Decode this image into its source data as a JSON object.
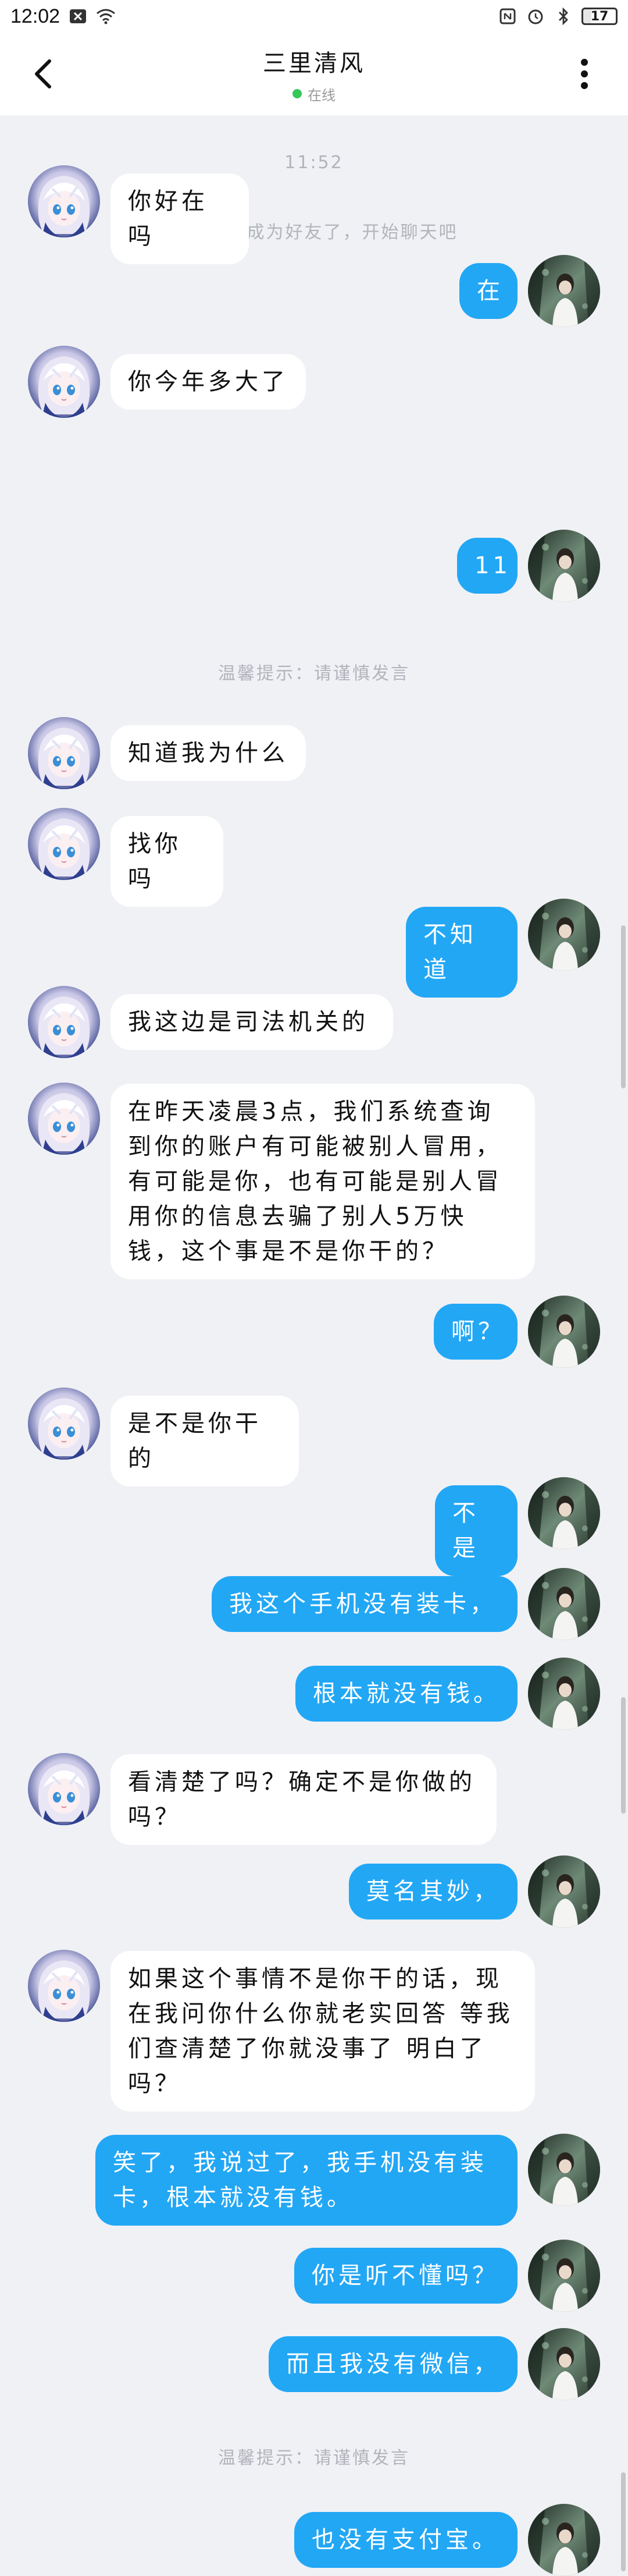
{
  "status_bar": {
    "time": "12:02",
    "battery": "17",
    "icons": [
      "notification-x-icon",
      "wifi-icon",
      "nfc-icon",
      "alarm-icon",
      "bluetooth-icon",
      "battery-icon"
    ]
  },
  "header": {
    "contact_name": "三里清风",
    "presence": "在线",
    "presence_color": "#34c759",
    "back_icon": "chevron-left-icon",
    "more_icon": "more-vertical-icon"
  },
  "chat": {
    "timestamp": "11:52",
    "friend_notice": "你们已经成为好友了，开始聊天吧",
    "tip_1": "温馨提示：请谨慎发言",
    "tip_2": "温馨提示：请谨慎发言",
    "incoming_color": "#ffffff",
    "outgoing_color": "#22a7f5",
    "messages": [
      {
        "side": "in",
        "text": "你好在吗"
      },
      {
        "side": "out",
        "text": "在"
      },
      {
        "side": "in",
        "text": "你今年多大了"
      },
      {
        "side": "out",
        "text": "11"
      },
      {
        "side": "in",
        "text": "知道我为什么"
      },
      {
        "side": "in",
        "text": "找你吗"
      },
      {
        "side": "out",
        "text": "不知道"
      },
      {
        "side": "in",
        "text": "我这边是司法机关的"
      },
      {
        "side": "in",
        "text": "在昨天凌晨3点，我们系统查询到你的账户有可能被别人冒用，有可能是你，也有可能是别人冒用你的信息去骗了别人5万快钱，这个事是不是你干的？"
      },
      {
        "side": "out",
        "text": "啊？"
      },
      {
        "side": "in",
        "text": "是不是你干的"
      },
      {
        "side": "out",
        "text": "不是"
      },
      {
        "side": "out",
        "text": "我这个手机没有装卡，"
      },
      {
        "side": "out",
        "text": "根本就没有钱。"
      },
      {
        "side": "in",
        "text": "看清楚了吗？确定不是你做的吗？"
      },
      {
        "side": "out",
        "text": "莫名其妙，"
      },
      {
        "side": "in",
        "text": "如果这个事情不是你干的话，现在我问你什么你就老实回答 等我们查清楚了你就没事了 明白了吗？"
      },
      {
        "side": "out",
        "text": "笑了，我说过了，我手机没有装卡，根本就没有钱。"
      },
      {
        "side": "out",
        "text": "你是听不懂吗？"
      },
      {
        "side": "out",
        "text": "而且我没有微信，"
      },
      {
        "side": "out",
        "text": "也没有支付宝。"
      }
    ]
  }
}
